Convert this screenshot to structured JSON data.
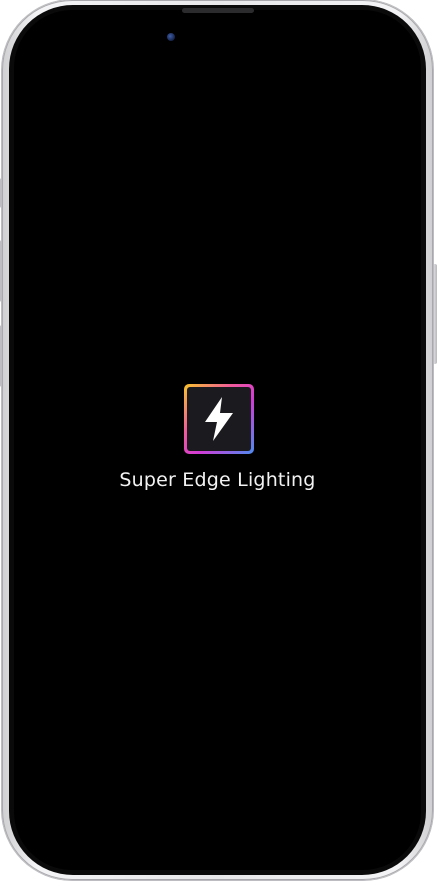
{
  "app": {
    "title": "Super Edge Lighting",
    "icon": "lightning-bolt-icon"
  },
  "colors": {
    "screen_background": "#000000",
    "icon_gradient": [
      "#f7c52a",
      "#f05a9b",
      "#d23bd6",
      "#4b8cf0"
    ],
    "icon_fill": "#1b1b1f",
    "title_text": "#f2f2f2"
  }
}
